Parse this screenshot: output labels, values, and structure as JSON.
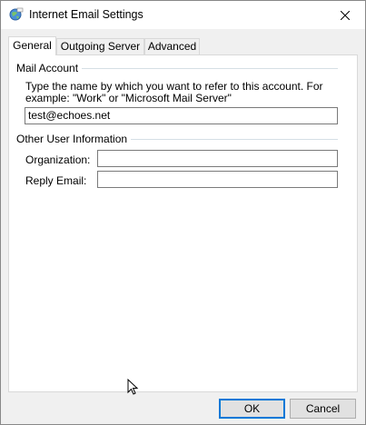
{
  "window": {
    "title": "Internet Email Settings",
    "icon": "globe-mail-icon",
    "close_icon": "close-icon"
  },
  "tabs": [
    {
      "label": "General",
      "active": true
    },
    {
      "label": "Outgoing Server",
      "active": false
    },
    {
      "label": "Advanced",
      "active": false
    }
  ],
  "mail_account": {
    "group_title": "Mail Account",
    "description": "Type the name by which you want to refer to this account. For example: \"Work\" or \"Microsoft Mail Server\"",
    "account_name_value": "test@echoes.net"
  },
  "other_user_info": {
    "group_title": "Other User Information",
    "organization_label": "Organization:",
    "organization_value": "",
    "reply_email_label": "Reply Email:",
    "reply_email_value": ""
  },
  "buttons": {
    "ok": "OK",
    "cancel": "Cancel"
  },
  "colors": {
    "accent": "#0078d7",
    "divider": "#d5dfe5"
  }
}
